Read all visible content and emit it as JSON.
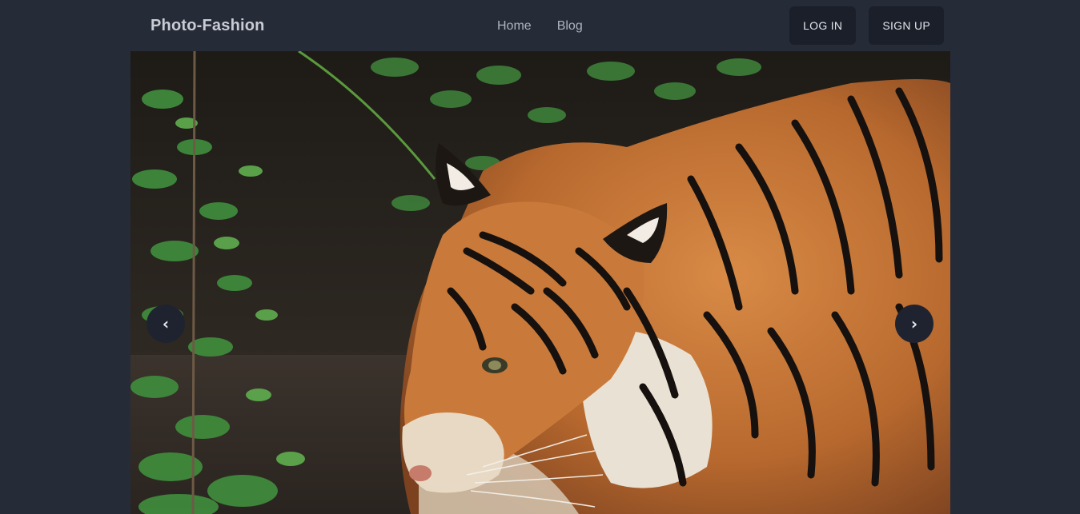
{
  "header": {
    "brand": "Photo-Fashion",
    "nav": [
      {
        "label": "Home"
      },
      {
        "label": "Blog"
      }
    ],
    "login_label": "LOG IN",
    "signup_label": "SIGN UP"
  },
  "carousel": {
    "prev_icon": "‹",
    "next_icon": "›",
    "slide_alt": "Tiger walking through jungle foliage"
  },
  "colors": {
    "background": "#262b38",
    "button_bg": "#1b1f2a"
  }
}
